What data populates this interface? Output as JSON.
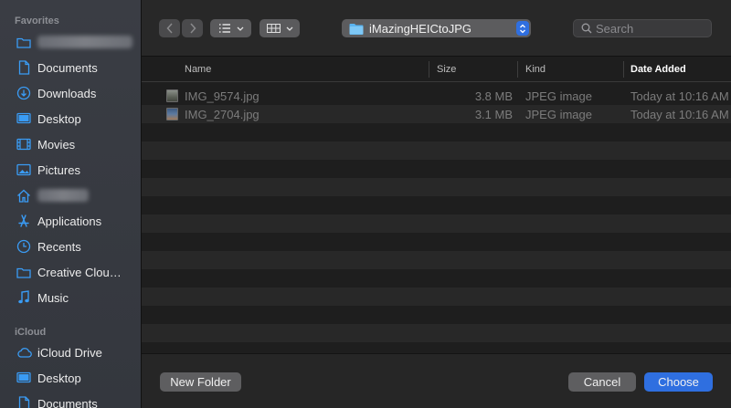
{
  "sidebar": {
    "favorites_title": "Favorites",
    "favorites": [
      {
        "label": "",
        "icon": "folder-icon",
        "blurred": true
      },
      {
        "label": "Documents",
        "icon": "document-icon"
      },
      {
        "label": "Downloads",
        "icon": "download-icon"
      },
      {
        "label": "Desktop",
        "icon": "desktop-icon"
      },
      {
        "label": "Movies",
        "icon": "film-icon"
      },
      {
        "label": "Pictures",
        "icon": "photo-icon"
      },
      {
        "label": "",
        "icon": "home-icon",
        "blurred": true
      },
      {
        "label": "Applications",
        "icon": "applications-icon"
      },
      {
        "label": "Recents",
        "icon": "clock-icon"
      },
      {
        "label": "Creative Cloud Files",
        "icon": "folder-icon"
      },
      {
        "label": "Music",
        "icon": "music-icon"
      }
    ],
    "icloud_title": "iCloud",
    "icloud": [
      {
        "label": "iCloud Drive",
        "icon": "cloud-icon"
      },
      {
        "label": "Desktop",
        "icon": "desktop-icon"
      },
      {
        "label": "Documents",
        "icon": "document-icon"
      }
    ]
  },
  "toolbar": {
    "path_label": "iMazingHEICtoJPG",
    "search_placeholder": "Search"
  },
  "table": {
    "columns": {
      "name": "Name",
      "size": "Size",
      "kind": "Kind",
      "date": "Date Added"
    },
    "rows": [
      {
        "name": "IMG_9574.jpg",
        "size": "3.8 MB",
        "kind": "JPEG image",
        "date": "Today at 10:16 AM"
      },
      {
        "name": "IMG_2704.jpg",
        "size": "3.1 MB",
        "kind": "JPEG image",
        "date": "Today at 10:16 AM"
      }
    ]
  },
  "footer": {
    "new_folder": "New Folder",
    "cancel": "Cancel",
    "choose": "Choose"
  },
  "colors": {
    "accent": "#2f6fe0",
    "sidebar_icon": "#3a9cf5"
  }
}
